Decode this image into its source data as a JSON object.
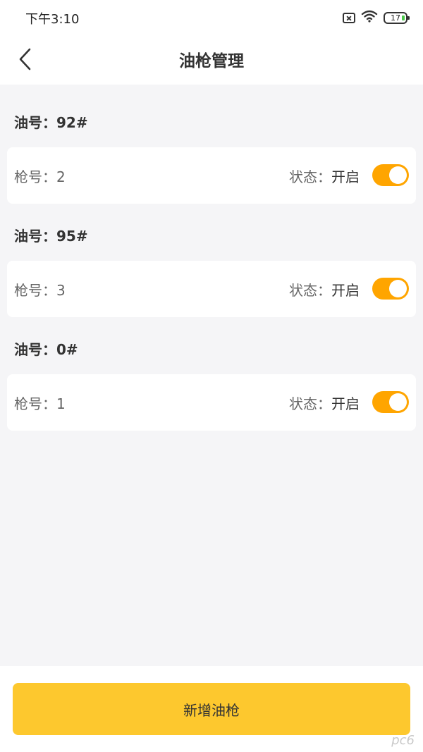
{
  "status_bar": {
    "time": "下午3:10",
    "battery_level": "17",
    "icons": [
      "sim-missing-icon",
      "wifi-icon",
      "battery-icon"
    ]
  },
  "nav": {
    "title": "油枪管理",
    "back_icon": "chevron-left-icon"
  },
  "groups": [
    {
      "title": "油号：92#",
      "gun": "枪号：2",
      "status_key": "状态：",
      "status_value": "开启",
      "enabled": true
    },
    {
      "title": "油号：95#",
      "gun": "枪号：3",
      "status_key": "状态：",
      "status_value": "开启",
      "enabled": true
    },
    {
      "title": "油号：0#",
      "gun": "枪号：1",
      "status_key": "状态：",
      "status_value": "开启",
      "enabled": true
    }
  ],
  "footer": {
    "add_button_label": "新增油枪"
  },
  "watermark": "pc6",
  "colors": {
    "accent_toggle": "#ffa500",
    "primary_button": "#fdc82e",
    "page_background": "#f5f5f7"
  }
}
